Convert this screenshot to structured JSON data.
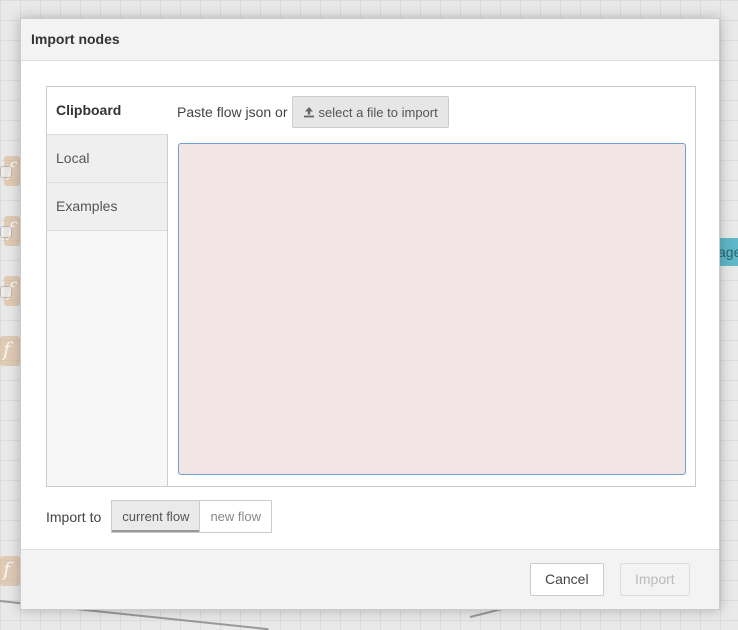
{
  "dialog": {
    "title": "Import nodes",
    "tabs": [
      {
        "label": "Clipboard",
        "active": true
      },
      {
        "label": "Local",
        "active": false
      },
      {
        "label": "Examples",
        "active": false
      }
    ],
    "paste_label": "Paste flow json or",
    "select_file_label": "select a file to import",
    "json_value": "",
    "import_to_label": "Import to",
    "import_to_options": [
      "current flow",
      "new flow"
    ],
    "import_to_selected": "current flow",
    "cancel_label": "Cancel",
    "import_label": "Import"
  },
  "canvas": {
    "function_glyph": "f",
    "partial_node_text": "age"
  },
  "colors": {
    "textarea_bg": "#f3e5e5",
    "textarea_border": "#6f9fd8",
    "node_color": "#d9b38c",
    "debug_node_color": "#5fb7c8"
  }
}
